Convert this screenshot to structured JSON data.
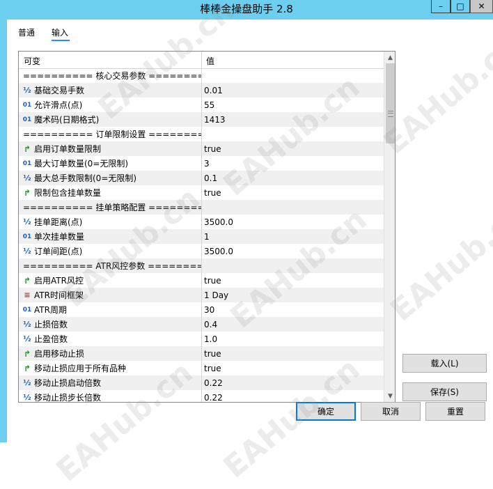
{
  "window": {
    "title": "棒棒金操盘助手 2.8",
    "controls": {
      "minimize": "–",
      "maximize": "□",
      "close": "✕"
    }
  },
  "tabs": [
    {
      "label": "普通",
      "active": false
    },
    {
      "label": "输入",
      "active": true
    }
  ],
  "grid": {
    "headers": {
      "name": "可变",
      "value": "值"
    },
    "rows": [
      {
        "type": "section",
        "name": "========== 核心交易参数 ==========",
        "value": ""
      },
      {
        "type": "double",
        "name": "基础交易手数",
        "value": "0.01"
      },
      {
        "type": "int",
        "name": "允许滑点(点)",
        "value": "55"
      },
      {
        "type": "int",
        "name": "魔术码(日期格式)",
        "value": "1413"
      },
      {
        "type": "section",
        "name": "========== 订单限制设置 ==========",
        "value": ""
      },
      {
        "type": "bool",
        "name": "启用订单数量限制",
        "value": "true"
      },
      {
        "type": "int",
        "name": "最大订单数量(0=无限制)",
        "value": "3"
      },
      {
        "type": "double",
        "name": "最大总手数限制(0=无限制)",
        "value": "0.1"
      },
      {
        "type": "bool",
        "name": "限制包含挂单数量",
        "value": "true"
      },
      {
        "type": "section",
        "name": "========== 挂单策略配置 ==========",
        "value": ""
      },
      {
        "type": "double",
        "name": "挂单距离(点)",
        "value": "3500.0"
      },
      {
        "type": "int",
        "name": "单次挂单数量",
        "value": "1"
      },
      {
        "type": "double",
        "name": "订单间距(点)",
        "value": "3500.0"
      },
      {
        "type": "section",
        "name": "========== ATR风控参数 ==========",
        "value": ""
      },
      {
        "type": "bool",
        "name": "启用ATR风控",
        "value": "true"
      },
      {
        "type": "enum",
        "name": "ATR时间框架",
        "value": "1 Day"
      },
      {
        "type": "int",
        "name": "ATR周期",
        "value": "30"
      },
      {
        "type": "double",
        "name": "止损倍数",
        "value": "0.4"
      },
      {
        "type": "double",
        "name": "止盈倍数",
        "value": "1.0"
      },
      {
        "type": "bool",
        "name": "启用移动止损",
        "value": "true"
      },
      {
        "type": "bool",
        "name": "移动止损应用于所有品种",
        "value": "true"
      },
      {
        "type": "double",
        "name": "移动止损启动倍数",
        "value": "0.22"
      },
      {
        "type": "double",
        "name": "移动止损步长倍数",
        "value": "0.22"
      }
    ],
    "icons": {
      "double": "½",
      "int": "01",
      "bool": "↱",
      "enum": "≡"
    }
  },
  "buttons": {
    "load": "载入(L)",
    "save": "保存(S)",
    "ok": "确定",
    "cancel": "取消",
    "reset": "重置"
  },
  "watermark": "EAHub.cn"
}
